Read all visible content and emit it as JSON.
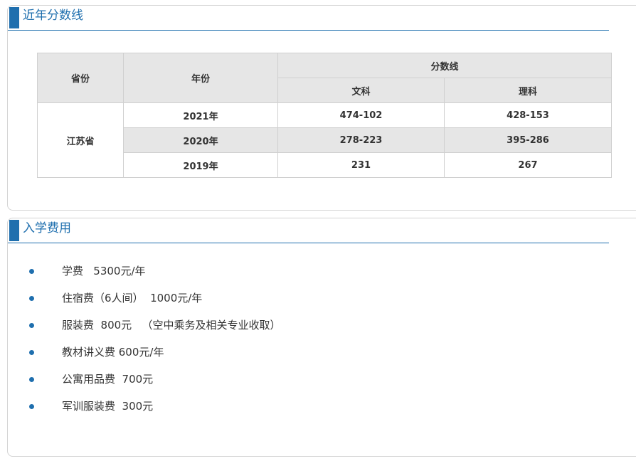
{
  "scores": {
    "heading": "近年分数线",
    "headers": {
      "province": "省份",
      "year": "年份",
      "score_line": "分数线",
      "arts": "文科",
      "science": "理科"
    },
    "province": "江苏省",
    "rows": [
      {
        "year": "2021年",
        "arts": "474-102",
        "science": "428-153"
      },
      {
        "year": "2020年",
        "arts": "278-223",
        "science": "395-286"
      },
      {
        "year": "2019年",
        "arts": "231",
        "science": "267"
      }
    ]
  },
  "fees": {
    "heading": "入学费用",
    "items": [
      "学费   5300元/年",
      "住宿费（6人间）  1000元/年",
      "服装费  800元   （空中乘务及相关专业收取）",
      "教材讲义费 600元/年",
      "公寓用品费  700元",
      "军训服装费  300元"
    ]
  },
  "colors": {
    "accent": "#1f6fae",
    "header_bg": "#e6e6e6",
    "border": "#d0d0d0"
  }
}
